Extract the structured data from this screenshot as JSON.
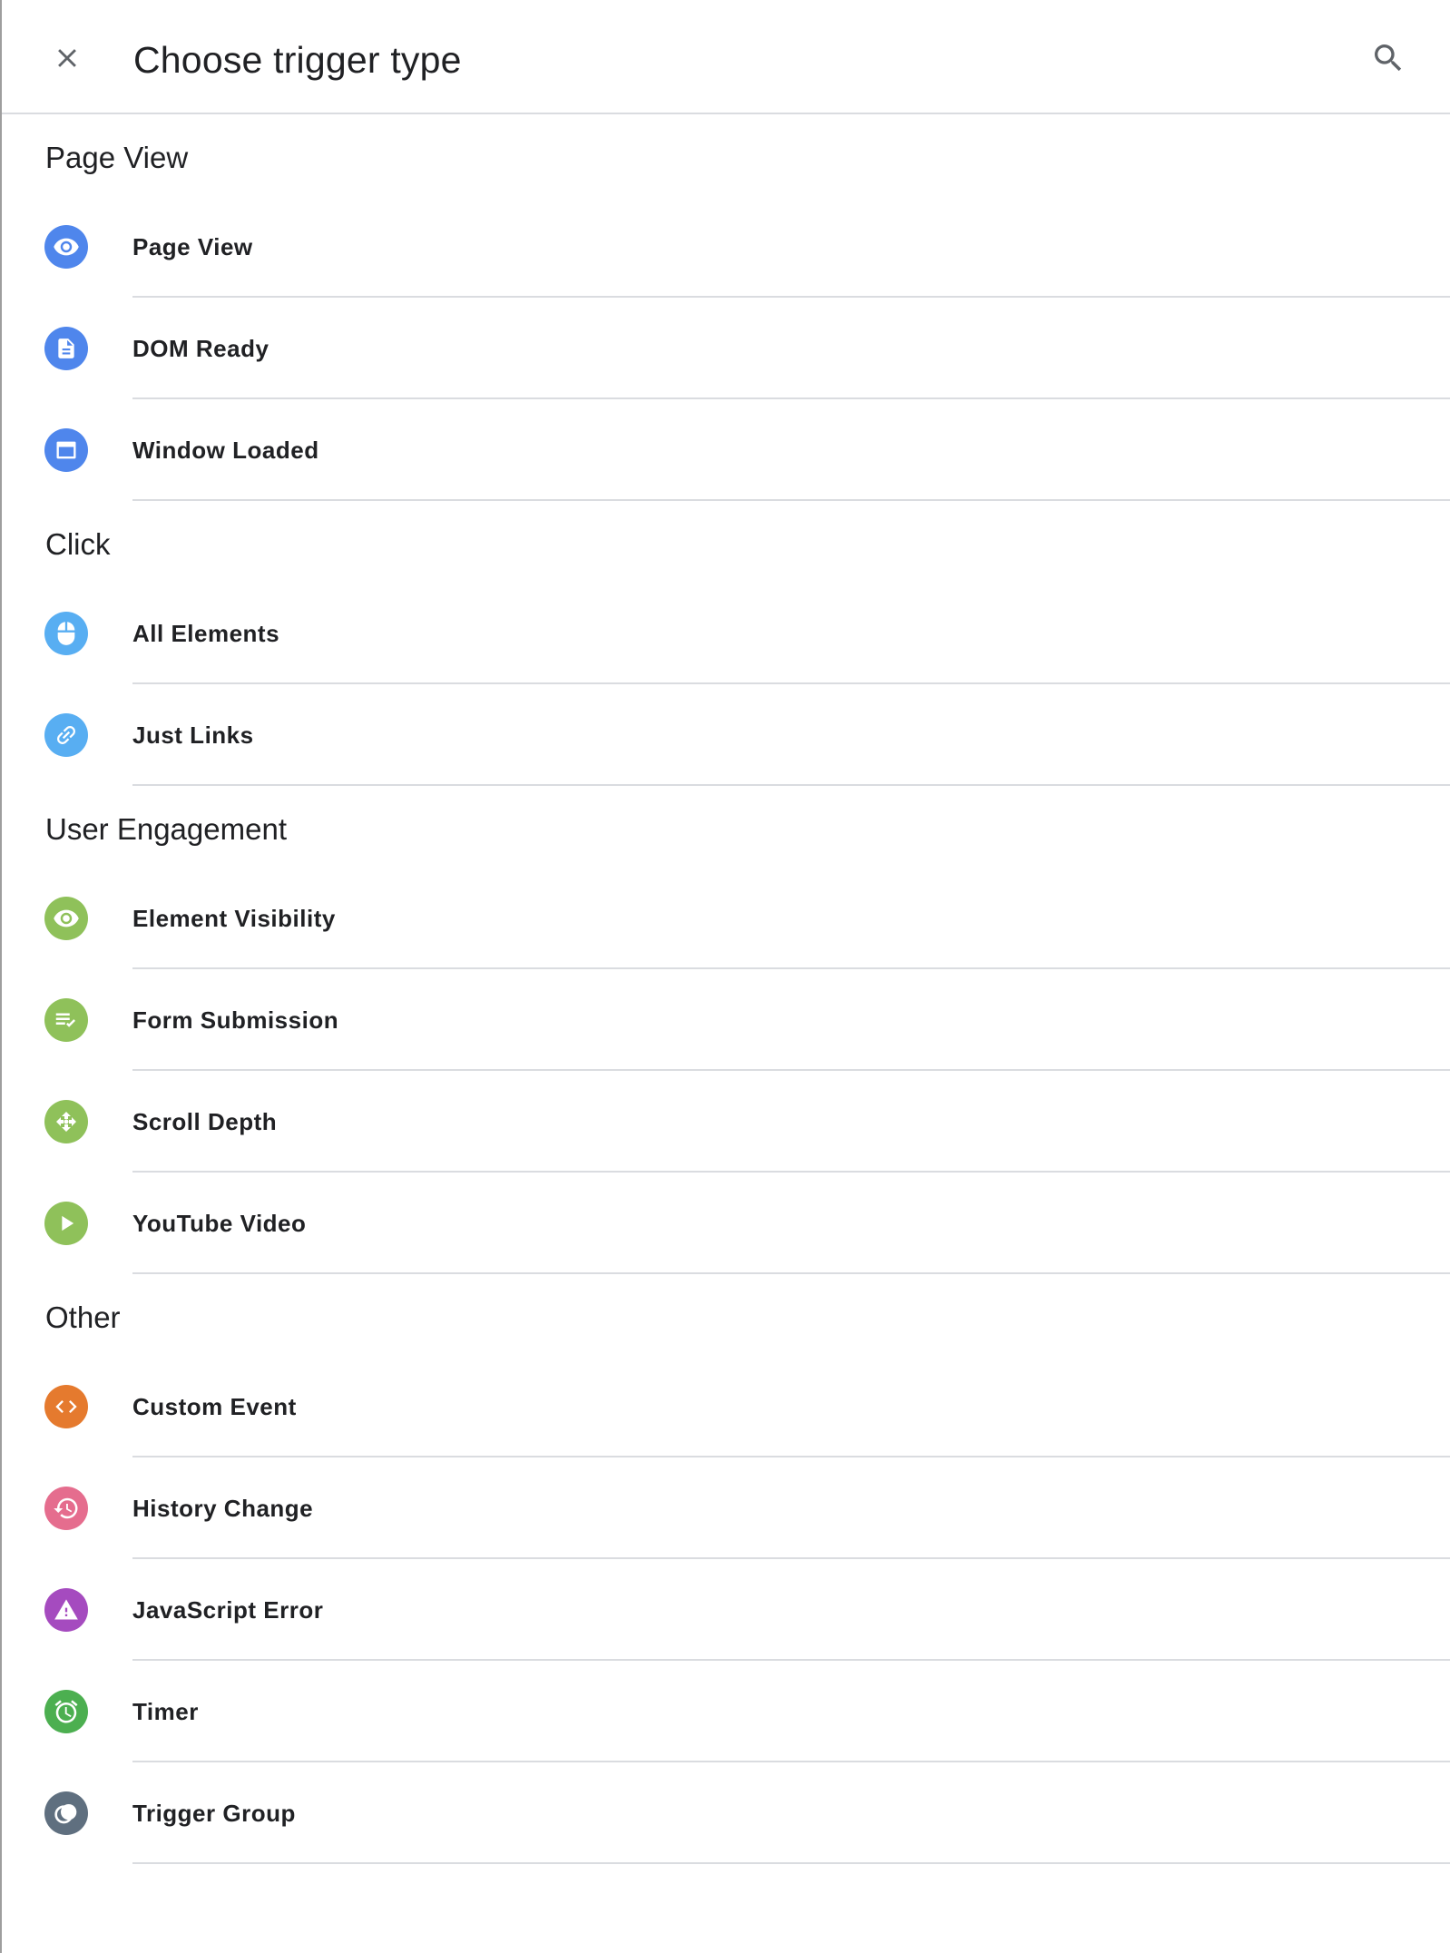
{
  "header": {
    "title": "Choose trigger type",
    "close_icon": "close-icon",
    "search_icon": "search-icon"
  },
  "sections": [
    {
      "title": "Page View",
      "items": [
        {
          "label": "Page View",
          "icon": "eye-icon",
          "color": "#4f86ec"
        },
        {
          "label": "DOM Ready",
          "icon": "document-icon",
          "color": "#4f86ec"
        },
        {
          "label": "Window Loaded",
          "icon": "window-icon",
          "color": "#4f86ec"
        }
      ]
    },
    {
      "title": "Click",
      "items": [
        {
          "label": "All Elements",
          "icon": "mouse-icon",
          "color": "#58aef2"
        },
        {
          "label": "Just Links",
          "icon": "link-icon",
          "color": "#58aef2"
        }
      ]
    },
    {
      "title": "User Engagement",
      "items": [
        {
          "label": "Element Visibility",
          "icon": "eye-icon",
          "color": "#8fc15a"
        },
        {
          "label": "Form Submission",
          "icon": "form-check-icon",
          "color": "#8fc15a"
        },
        {
          "label": "Scroll Depth",
          "icon": "scroll-move-icon",
          "color": "#8fc15a"
        },
        {
          "label": "YouTube Video",
          "icon": "play-icon",
          "color": "#8fc15a"
        }
      ]
    },
    {
      "title": "Other",
      "items": [
        {
          "label": "Custom Event",
          "icon": "code-icon",
          "color": "#e57a2e"
        },
        {
          "label": "History Change",
          "icon": "history-icon",
          "color": "#e56d8e"
        },
        {
          "label": "JavaScript Error",
          "icon": "warning-icon",
          "color": "#a54bbf"
        },
        {
          "label": "Timer",
          "icon": "alarm-icon",
          "color": "#4caf50"
        },
        {
          "label": "Trigger Group",
          "icon": "trigger-group-icon",
          "color": "#5f6f7f"
        }
      ]
    }
  ]
}
